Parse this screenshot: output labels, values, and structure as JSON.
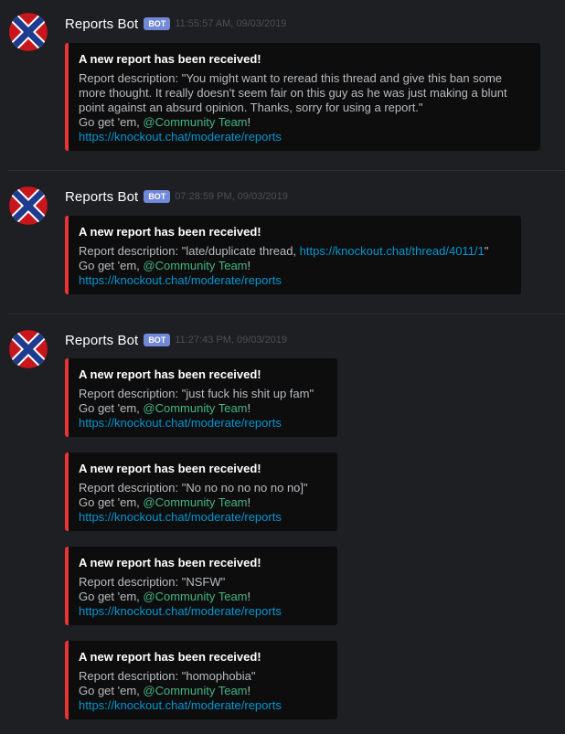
{
  "messages": [
    {
      "username": "Reports Bot",
      "bot_tag": "BOT",
      "timestamp": "11:55:57 AM, 09/03/2019",
      "embeds": [
        {
          "title": "A new report has been received!",
          "desc_prefix": "Report description: ",
          "desc": "\"You might want to reread this thread and give this ban some more thought. It really doesn't seem fair on this guy as he was just making a blunt point against an absurd opinion. Thanks, sorry for using a report.\"",
          "goget_prefix": "Go get 'em, ",
          "mention": "@Community Team",
          "goget_suffix": "!",
          "url": "https://knockout.chat/moderate/reports"
        }
      ]
    },
    {
      "username": "Reports Bot",
      "bot_tag": "BOT",
      "timestamp": "07:28:59 PM, 09/03/2019",
      "embeds": [
        {
          "title": "A new report has been received!",
          "desc_prefix": "Report description: ",
          "desc": "\"late/duplicate thread, ",
          "desc_link": "https://knockout.chat/thread/4011/1",
          "desc_suffix": "\"",
          "goget_prefix": "Go get 'em, ",
          "mention": "@Community Team",
          "goget_suffix": "!",
          "url": "https://knockout.chat/moderate/reports"
        }
      ]
    },
    {
      "username": "Reports Bot",
      "bot_tag": "BOT",
      "timestamp": "11:27:43 PM, 09/03/2019",
      "embeds": [
        {
          "title": "A new report has been received!",
          "desc_prefix": "Report description: ",
          "desc": "\"just fuck his shit up fam\"",
          "goget_prefix": "Go get 'em, ",
          "mention": "@Community Team",
          "goget_suffix": "!",
          "url": "https://knockout.chat/moderate/reports"
        },
        {
          "title": "A new report has been received!",
          "desc_prefix": "Report description: ",
          "desc": "\"No no no no no no no]\"",
          "goget_prefix": "Go get 'em, ",
          "mention": "@Community Team",
          "goget_suffix": "!",
          "url": "https://knockout.chat/moderate/reports"
        },
        {
          "title": "A new report has been received!",
          "desc_prefix": "Report description: ",
          "desc": "\"NSFW\"",
          "goget_prefix": "Go get 'em, ",
          "mention": "@Community Team",
          "goget_suffix": "!",
          "url": "https://knockout.chat/moderate/reports"
        },
        {
          "title": "A new report has been received!",
          "desc_prefix": "Report description: ",
          "desc": "\"homophobia\"",
          "goget_prefix": "Go get 'em, ",
          "mention": "@Community Team",
          "goget_suffix": "!",
          "url": "https://knockout.chat/moderate/reports"
        }
      ]
    }
  ],
  "colors": {
    "background": "#1e1f23",
    "embed_bg": "#0d0d0e",
    "embed_border": "#e83434",
    "mention": "#43b581",
    "link": "#0096cf",
    "bot_tag": "#7289da"
  },
  "icons": {
    "avatar": "flag-avatar-icon"
  }
}
